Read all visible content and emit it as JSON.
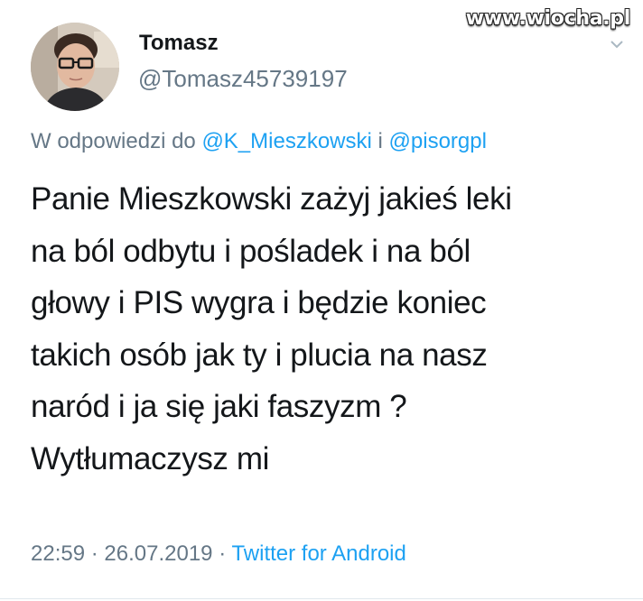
{
  "watermark": "www.wiocha.pl",
  "author": {
    "name": "Tomasz",
    "handle": "@Tomasz45739197"
  },
  "reply": {
    "prefix": "W odpowiedzi do",
    "mention_1": "@K_Mieszkowski",
    "conjunction": "i",
    "mention_2": "@pisorgpl"
  },
  "tweet": {
    "text": "Panie Mieszkowski zażyj jakieś leki\nna ból odbytu i pośladek i na ból\ngłowy i PIS wygra i będzie koniec\ntakich osób jak ty i plucia na nasz\nnaród i ja się jaki faszyzm ?\nWytłumaczysz mi"
  },
  "meta": {
    "time": "22:59",
    "separator": "·",
    "date": "26.07.2019",
    "source": "Twitter for Android"
  },
  "colors": {
    "link": "#1da1f2",
    "secondary_text": "#657786",
    "primary_text": "#14171a"
  },
  "icons": {
    "more": "chevron-down-icon",
    "avatar": "profile-photo"
  }
}
